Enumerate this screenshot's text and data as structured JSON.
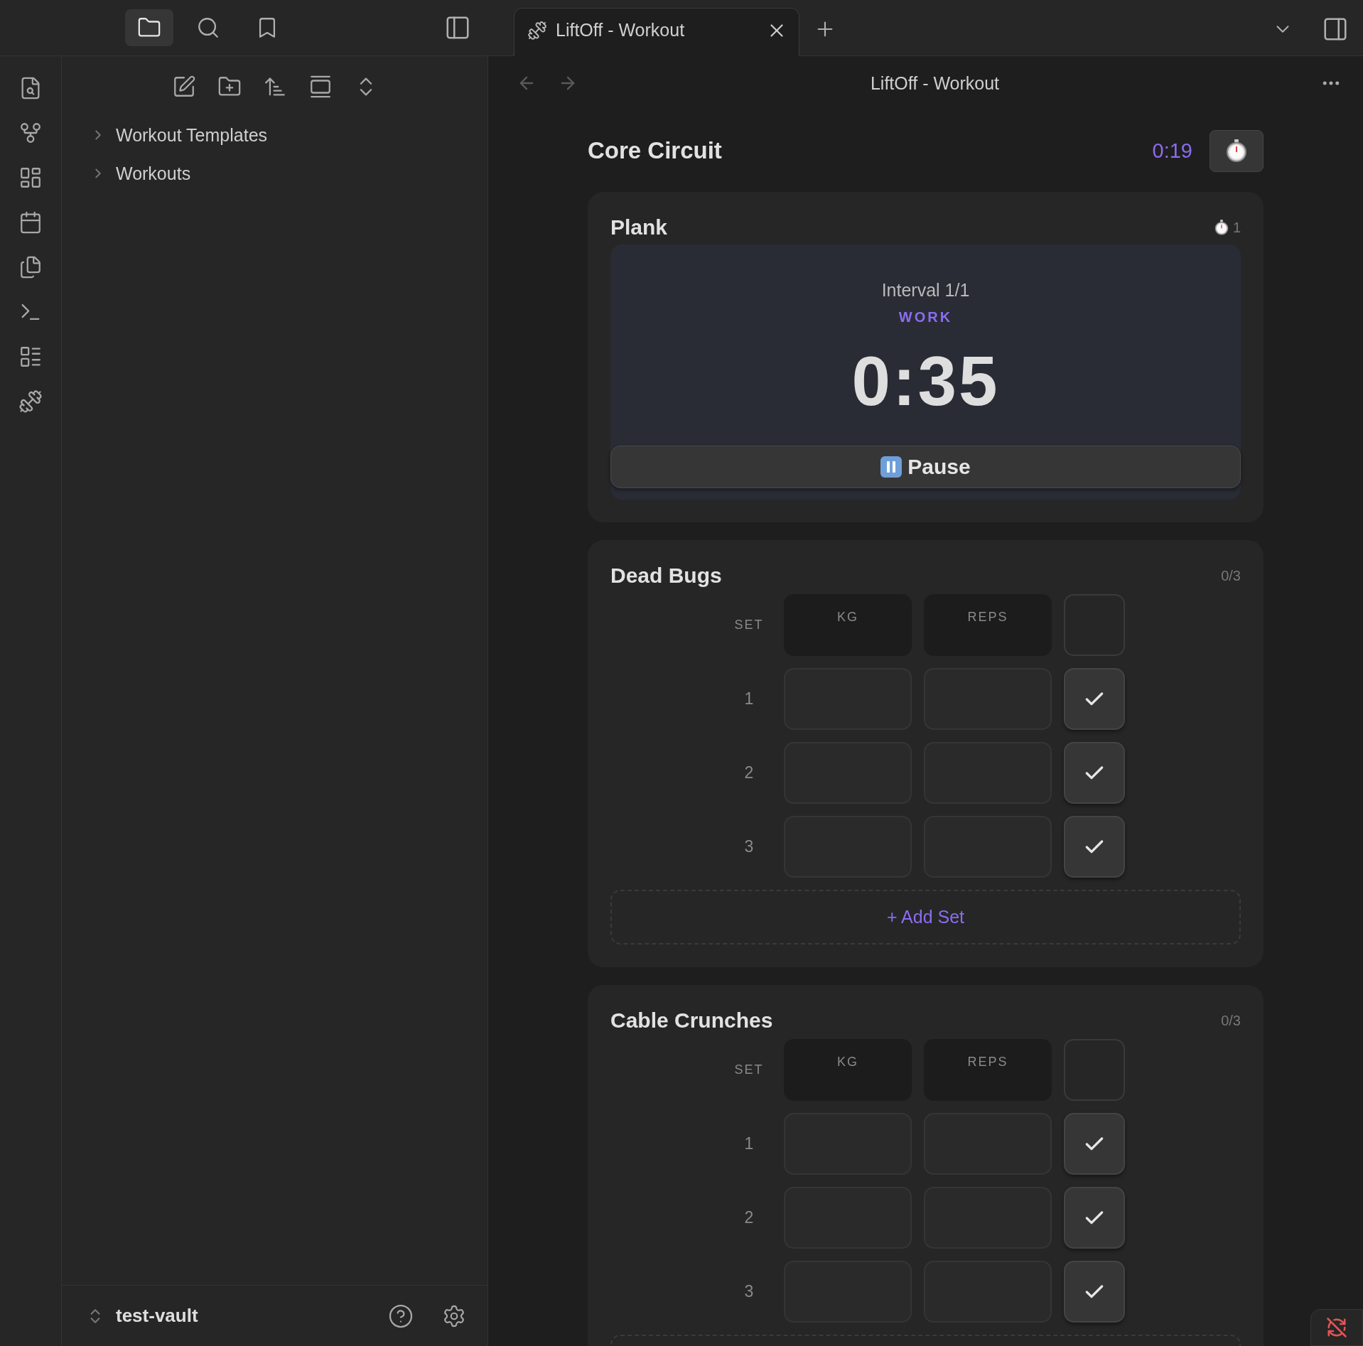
{
  "sidebar_tabs": [
    {
      "selected": true
    },
    {
      "selected": false
    },
    {
      "selected": false
    }
  ],
  "file_tree": [
    {
      "label": "Workout Templates",
      "expanded": false
    },
    {
      "label": "Workouts",
      "expanded": false
    }
  ],
  "vault": {
    "name": "test-vault"
  },
  "tab": {
    "title": "LiftOff - Workout",
    "selected": true
  },
  "view_title": "LiftOff - Workout",
  "workout": {
    "title": "Core Circuit",
    "elapsed": "0:19"
  },
  "exercises": [
    {
      "kind": "interval",
      "name": "Plank",
      "badge": "1",
      "interval": "Interval 1/1",
      "phase": "WORK",
      "countdown": "0:35",
      "button": "Pause"
    },
    {
      "kind": "sets",
      "name": "Dead Bugs",
      "progress": {
        "text": "0/3",
        "complete": false
      },
      "columns": [
        "SET",
        "KG",
        "REPS"
      ],
      "sets": [
        {
          "number": "1",
          "done": false
        },
        {
          "number": "2",
          "done": false
        },
        {
          "number": "3",
          "done": false
        }
      ],
      "add_label": "+ Add Set"
    },
    {
      "kind": "sets",
      "name": "Cable Crunches",
      "progress": {
        "text": "0/3",
        "complete": false
      },
      "columns": [
        "SET",
        "KG",
        "REPS"
      ],
      "sets": [
        {
          "number": "1",
          "done": false
        },
        {
          "number": "2",
          "done": false
        },
        {
          "number": "3",
          "done": false
        }
      ]
    }
  ],
  "sync": {
    "ok": false
  }
}
